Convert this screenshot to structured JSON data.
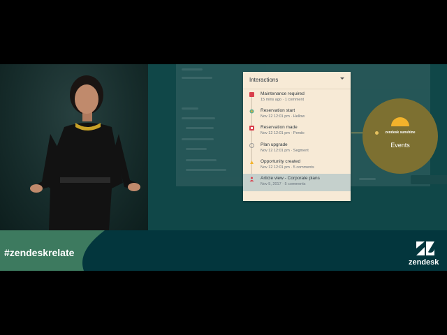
{
  "banner": {
    "hashtag": "#zendeskrelate",
    "brand": "zendesk"
  },
  "interactions_card": {
    "title": "Interactions",
    "items": [
      {
        "title": "Maintenance required",
        "meta": "15 mins ago · 1 comment",
        "icon": "wrench-icon",
        "color": "#d93f4c"
      },
      {
        "title": "Reservation start",
        "meta": "Nov 12 12:01 pm · Hellow",
        "icon": "location-pin-icon",
        "color": "#5eae91"
      },
      {
        "title": "Reservation made",
        "meta": "Nov 12 12:01 pm · Pendo",
        "icon": "calendar-icon",
        "color": "#d93f4c"
      },
      {
        "title": "Plan upgrade",
        "meta": "Nov 12 12:01 pm · Segment",
        "icon": "upgrade-icon",
        "color": "#999999"
      },
      {
        "title": "Opportunity created",
        "meta": "Nov 12 12:01 pm · 5 comments",
        "icon": "opportunity-icon",
        "color": "#f3b32b"
      },
      {
        "title": "Article view - Corporate plans",
        "meta": "Nov 5, 2017 · 5 comments",
        "icon": "person-icon",
        "color": "#d93f4c"
      }
    ]
  },
  "events_bubble": {
    "brand_label": "zendesk sunshine",
    "label": "Events"
  },
  "colors": {
    "banner": "#03363d",
    "screen": "#104748",
    "card": "#f7ead6",
    "bubble": "#7d7031",
    "sun": "#f3b32b"
  }
}
